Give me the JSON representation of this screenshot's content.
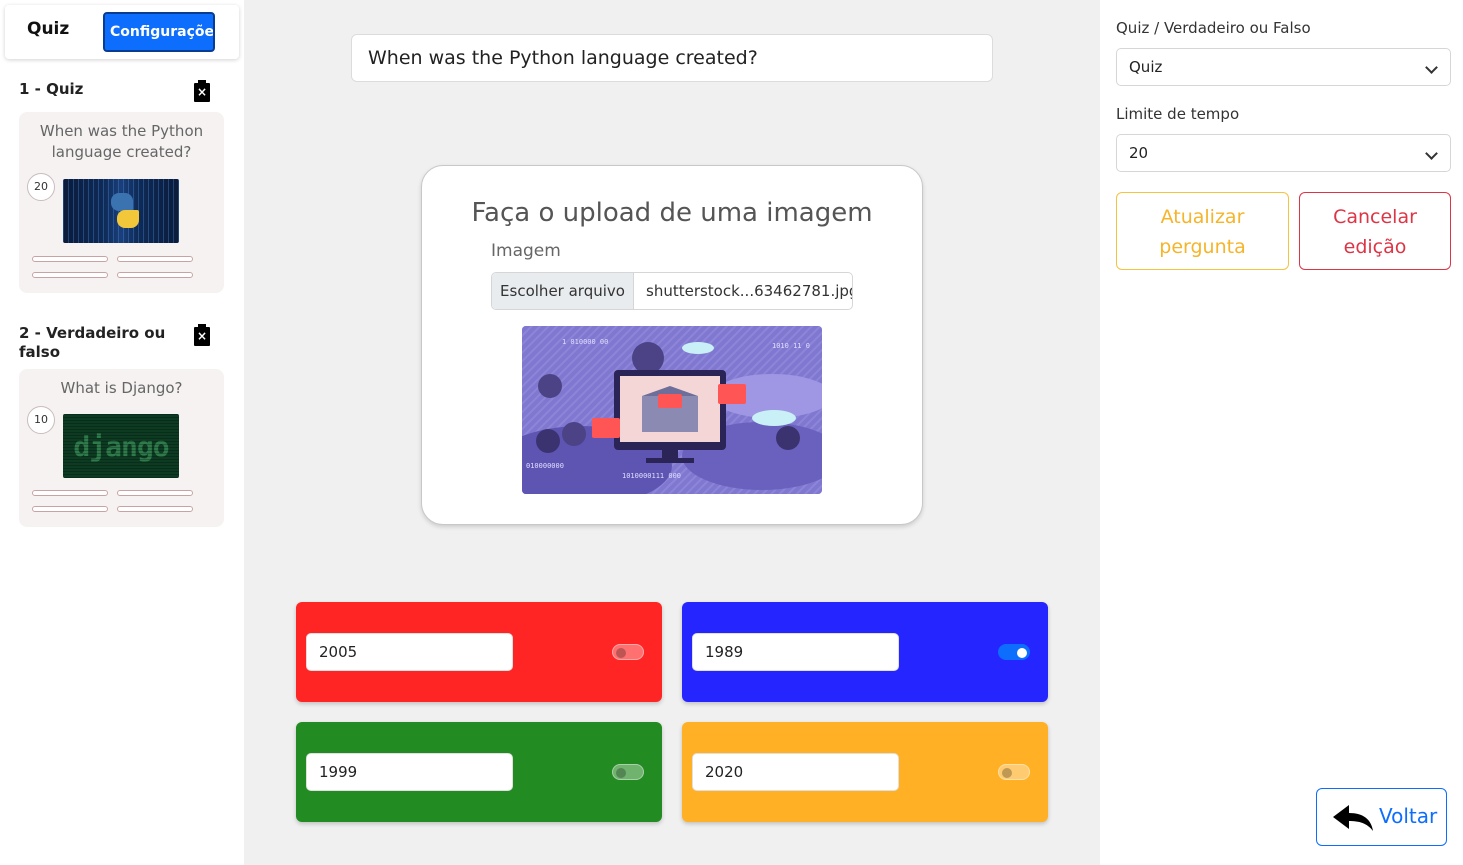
{
  "sidebar": {
    "tab_quiz": "Quiz",
    "tab_config": "Configurações",
    "questions": [
      {
        "title": "1 - Quiz",
        "text": "When was the Python language created?",
        "time": "20",
        "image": "python-thumbnail",
        "delete_icon": "trash-x-icon"
      },
      {
        "title": "2 - Verdadeiro ou falso",
        "text": "What is Django?",
        "time": "10",
        "image": "django-thumbnail",
        "delete_icon": "trash-x-icon"
      }
    ]
  },
  "main": {
    "question_value": "When was the Python language created?",
    "upload": {
      "title": "Faça o upload de uma imagem",
      "label": "Imagem",
      "file_button": "Escolher arquivo",
      "file_name": "shutterstock...63462781.jpg"
    },
    "answers": [
      {
        "value": "2005",
        "color": "#ff2525",
        "correct": false
      },
      {
        "value": "1989",
        "color": "#2525ff",
        "correct": true
      },
      {
        "value": "1999",
        "color": "#228b22",
        "correct": false
      },
      {
        "value": "2020",
        "color": "#ffb025",
        "correct": false
      }
    ]
  },
  "settings": {
    "type_label": "Quiz / Verdadeiro ou Falso",
    "type_value": "Quiz",
    "time_label": "Limite de tempo",
    "time_value": "20",
    "update_button": "Atualizar pergunta",
    "cancel_button": "Cancelar edição",
    "back_button": "Voltar",
    "back_icon": "reply-arrow-icon"
  }
}
